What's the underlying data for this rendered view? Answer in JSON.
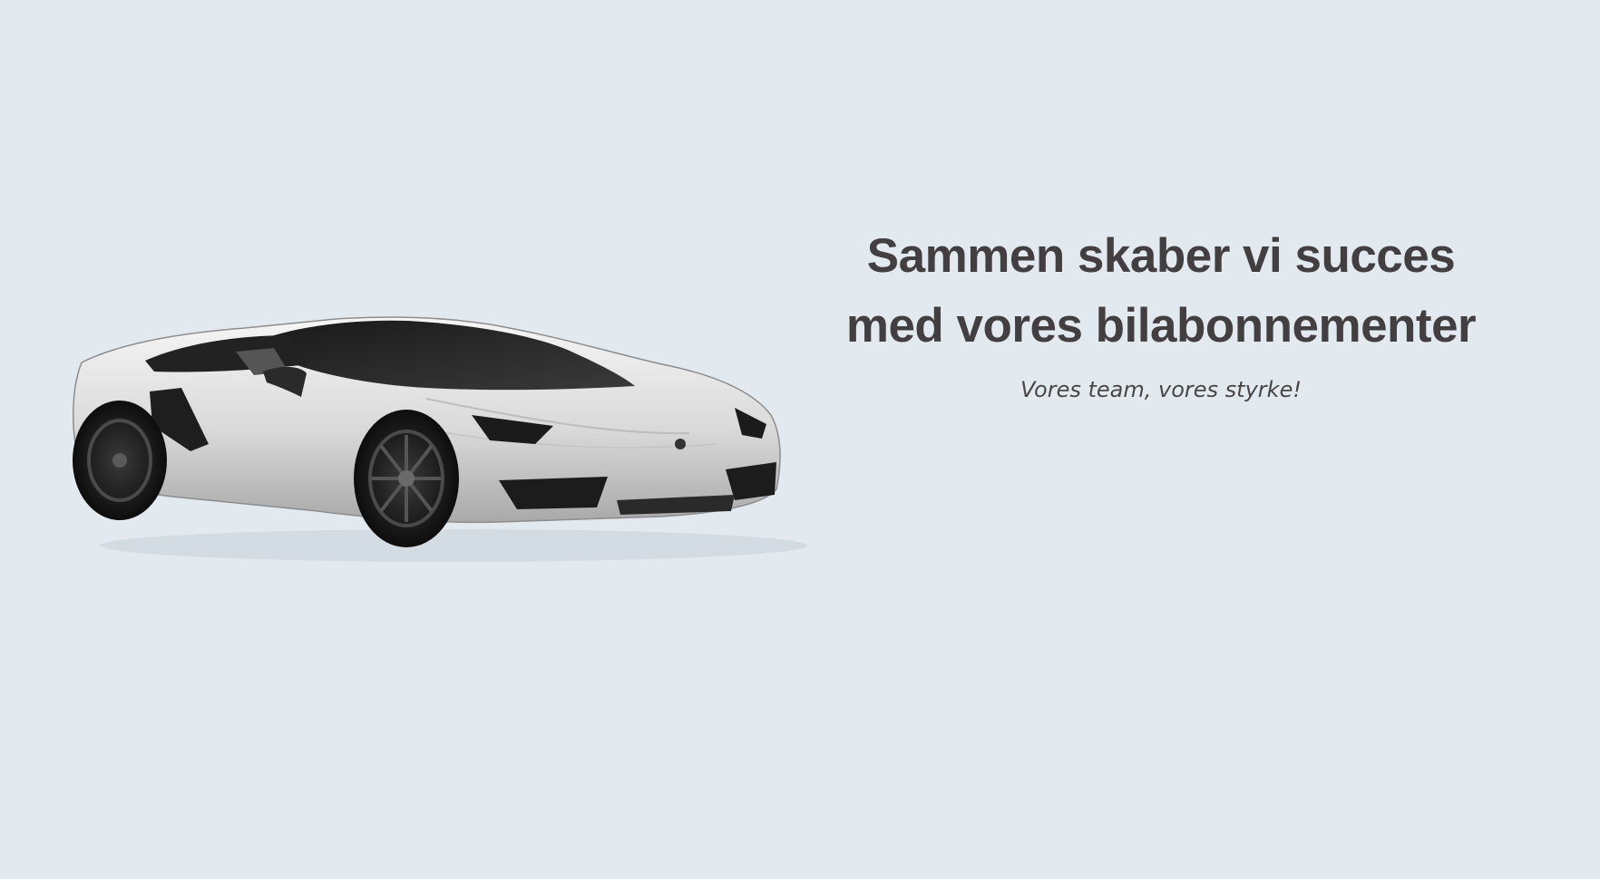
{
  "hero": {
    "headline": "Sammen skaber vi succes med vores bilabonnementer",
    "tagline": "Vores team, vores styrke!",
    "image": {
      "subject": "white-sports-car"
    },
    "colors": {
      "background": "#e2eaef",
      "headline": "#433f40",
      "tagline": "#4a4648"
    }
  }
}
